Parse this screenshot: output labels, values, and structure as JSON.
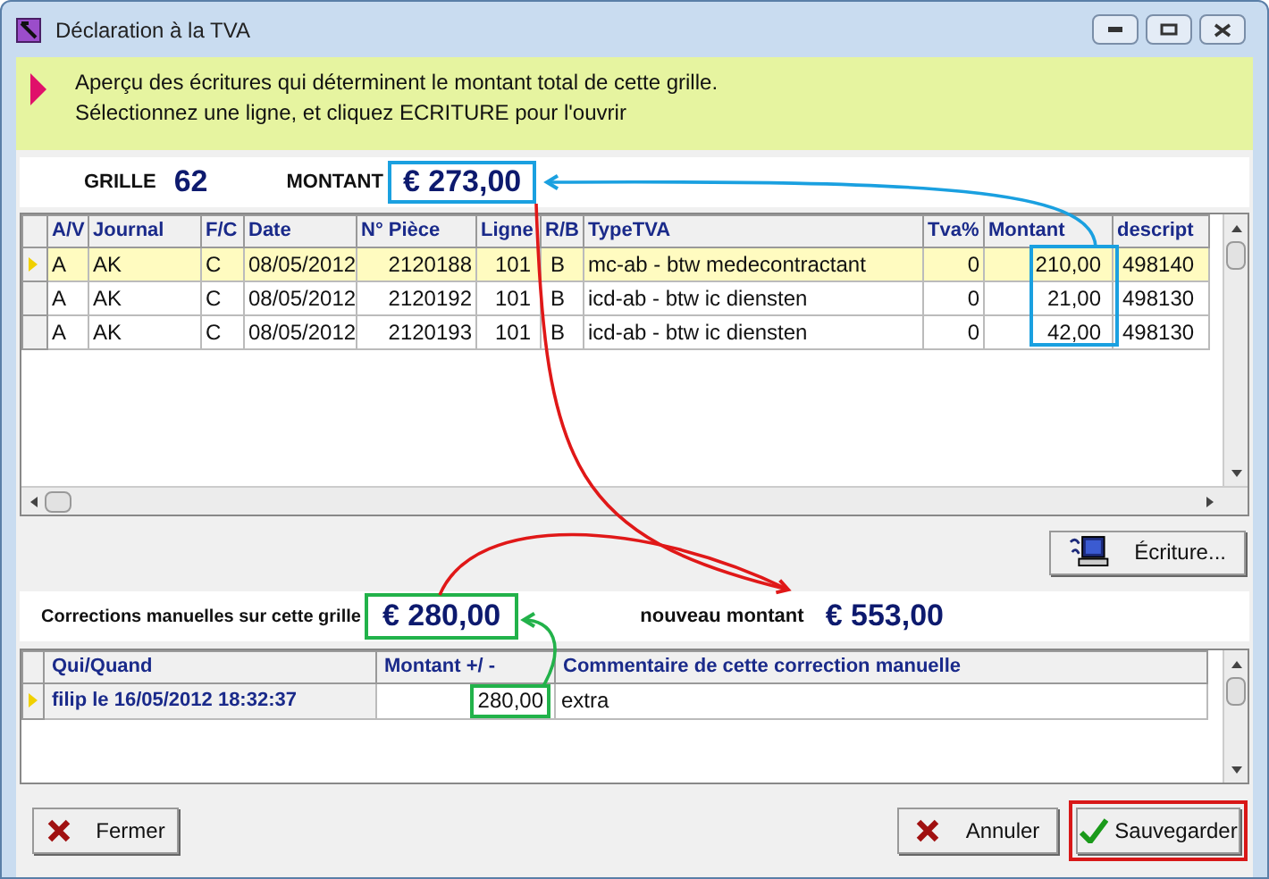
{
  "window": {
    "title": "Déclaration à la TVA"
  },
  "info": {
    "lines": [
      "Aperçu des écritures qui déterminent le montant total de cette grille.",
      "Sélectionnez une ligne, et cliquez ECRITURE pour l'ouvrir"
    ]
  },
  "grille": {
    "label": "GRILLE",
    "value": "62",
    "amount_label": "MONTANT",
    "amount": "€ 273,00"
  },
  "entries": {
    "columns": [
      "A/V",
      "Journal",
      "F/C",
      "Date",
      "N° Pièce",
      "Ligne",
      "R/B",
      "TypeTVA",
      "Tva%",
      "Montant",
      "descript"
    ],
    "rows": [
      {
        "selected": true,
        "cells": [
          "A",
          "AK",
          "C",
          "08/05/2012",
          "2120188",
          "101",
          "B",
          "mc-ab - btw medecontractant",
          "0",
          "210,00",
          "498140"
        ]
      },
      {
        "selected": false,
        "cells": [
          "A",
          "AK",
          "C",
          "08/05/2012",
          "2120192",
          "101",
          "B",
          "icd-ab - btw ic diensten",
          "0",
          "21,00",
          "498130"
        ]
      },
      {
        "selected": false,
        "cells": [
          "A",
          "AK",
          "C",
          "08/05/2012",
          "2120193",
          "101",
          "B",
          "icd-ab - btw ic diensten",
          "0",
          "42,00",
          "498130"
        ]
      }
    ]
  },
  "ecriture_button": {
    "label": "Écriture..."
  },
  "corrections": {
    "label": "Corrections manuelles sur cette grille",
    "amount": "€ 280,00",
    "new_label": "nouveau montant",
    "new_amount": "€ 553,00",
    "columns": [
      "Qui/Quand",
      "Montant +/ -",
      "Commentaire de cette correction manuelle"
    ],
    "rows": [
      {
        "selected": true,
        "cells": [
          "filip le 16/05/2012 18:32:37",
          "280,00",
          "extra"
        ]
      }
    ]
  },
  "buttons": [
    {
      "kind": "close",
      "label": "Fermer",
      "highlighted": false
    },
    {
      "kind": "cancel",
      "label": "Annuler",
      "highlighted": false
    },
    {
      "kind": "save",
      "label": "Sauvegarder",
      "highlighted": true
    }
  ]
}
